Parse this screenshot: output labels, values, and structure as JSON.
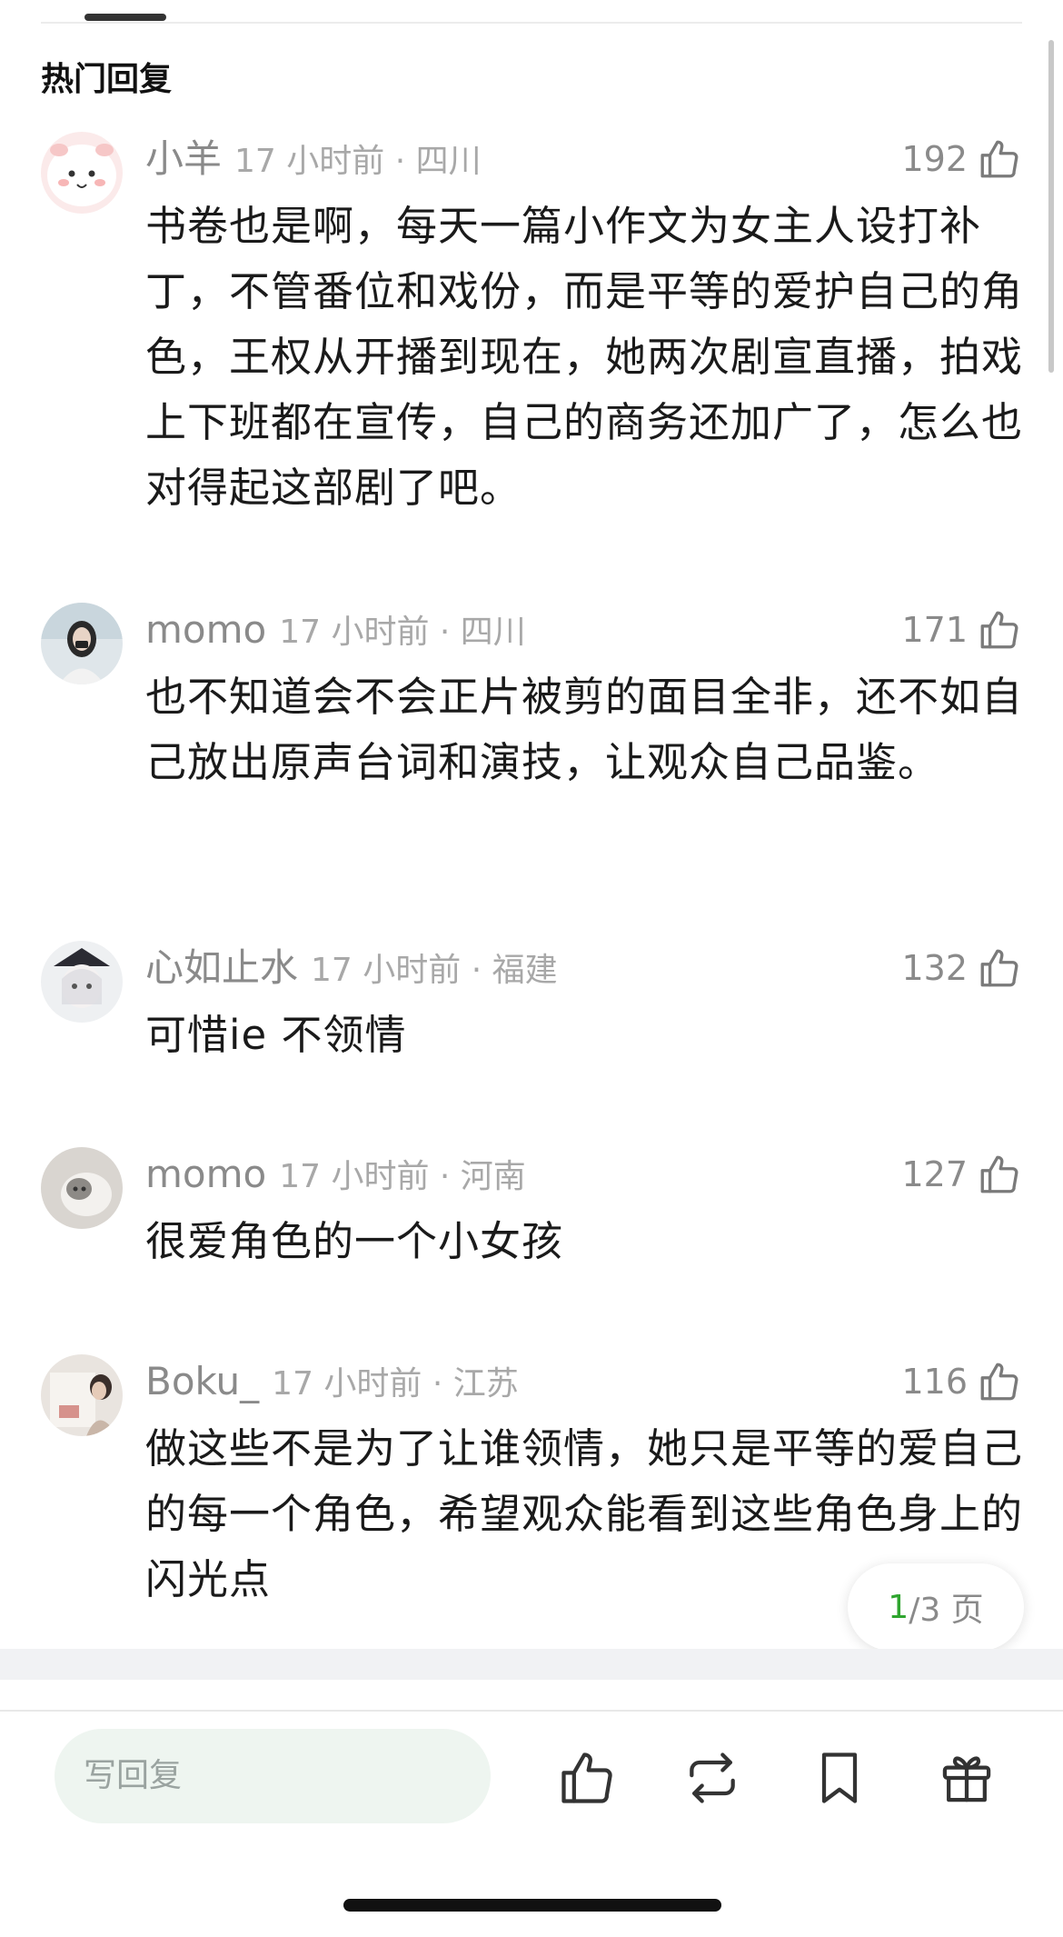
{
  "section": {
    "title": "热门回复"
  },
  "comments": [
    {
      "username": "小羊",
      "time_location": "17 小时前 · 四川",
      "likes": "192",
      "text": "书卷也是啊，每天一篇小作文为女主人设打补丁，不管番位和戏份，而是平等的爱护自己的角色，王权从开播到现在，她两次剧宣直播，拍戏上下班都在宣传，自己的商务还加广了，怎么也对得起这部剧了吧。"
    },
    {
      "username": "momo",
      "time_location": "17 小时前 · 四川",
      "likes": "171",
      "text": "也不知道会不会正片被剪的面目全非，还不如自己放出原声台词和演技，让观众自己品鉴。"
    },
    {
      "username": "心如止水",
      "time_location": "17 小时前 · 福建",
      "likes": "132",
      "text": "可惜ie 不领情"
    },
    {
      "username": "momo",
      "time_location": "17 小时前 · 河南",
      "likes": "127",
      "text": "很爱角色的一个小女孩"
    },
    {
      "username": "Boku_",
      "time_location": "17 小时前 · 江苏",
      "likes": "116",
      "text": "做这些不是为了让谁领情，她只是平等的爱自己的每一个角色，希望观众能看到这些角色身上的闪光点"
    }
  ],
  "pagination": {
    "current": "1",
    "rest": "/3 页"
  },
  "footer": {
    "reply_placeholder": "写回复",
    "icons": [
      "thumbs-up-icon",
      "repost-icon",
      "bookmark-icon",
      "gift-icon"
    ]
  },
  "colors": {
    "accent_green": "#2fa52f",
    "secondary_text": "#8a8a8a",
    "reply_input_bg": "#eef5f0"
  }
}
